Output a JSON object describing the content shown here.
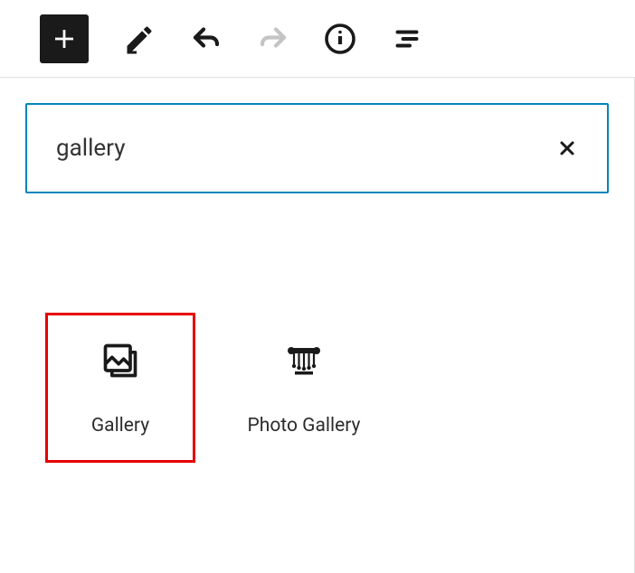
{
  "search": {
    "value": "gallery",
    "placeholder": "Search"
  },
  "results": [
    {
      "label": "Gallery",
      "icon": "gallery-icon",
      "highlighted": true
    },
    {
      "label": "Photo Gallery",
      "icon": "photo-gallery-icon",
      "highlighted": false
    }
  ]
}
